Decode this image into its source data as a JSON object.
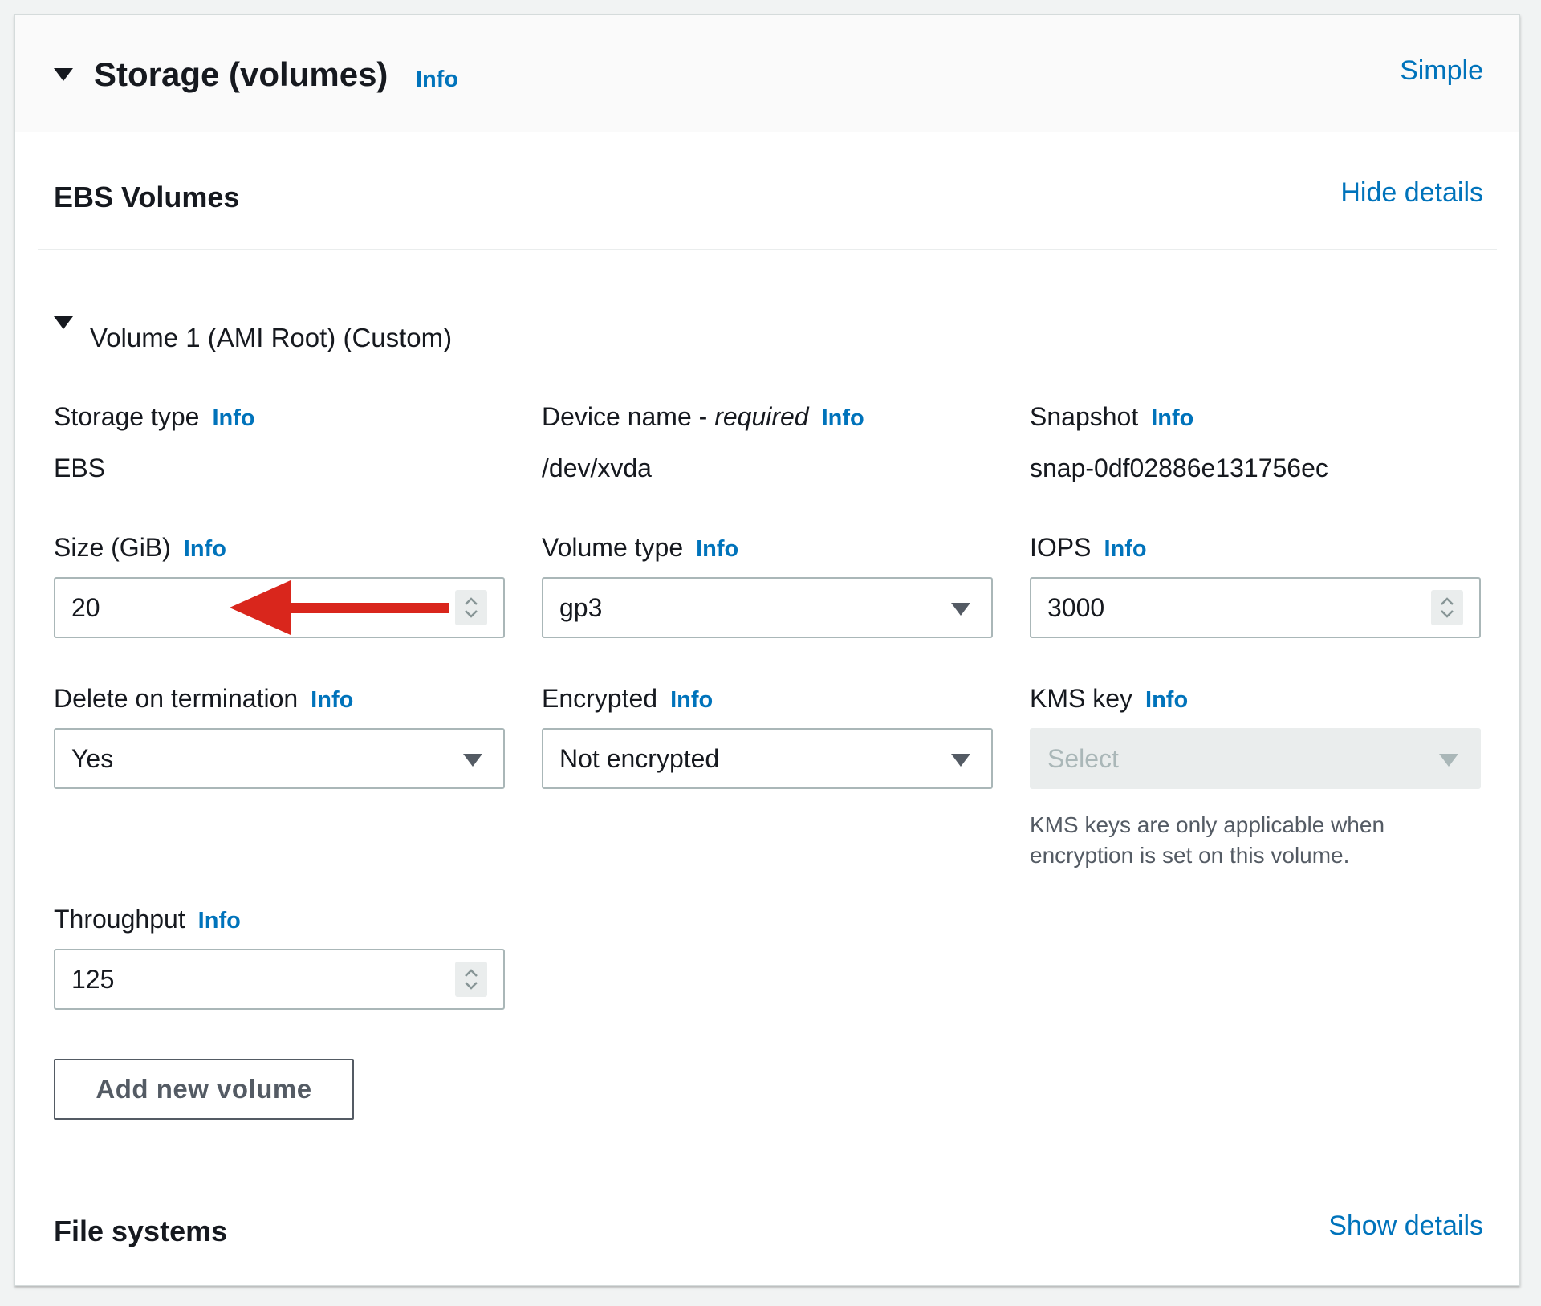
{
  "header": {
    "title": "Storage (volumes)",
    "info_label": "Info",
    "mode_link": "Simple"
  },
  "ebs": {
    "title": "EBS Volumes",
    "toggle_link": "Hide details",
    "volume_title": "Volume 1 (AMI Root) (Custom)"
  },
  "fields": {
    "storage_type": {
      "label": "Storage type",
      "info": "Info",
      "value": "EBS"
    },
    "device_name": {
      "label": "Device name - ",
      "label_em": "required",
      "info": "Info",
      "value": "/dev/xvda"
    },
    "snapshot": {
      "label": "Snapshot",
      "info": "Info",
      "value": "snap-0df02886e131756ec"
    },
    "size": {
      "label": "Size (GiB)",
      "info": "Info",
      "value": "20"
    },
    "volume_type": {
      "label": "Volume type",
      "info": "Info",
      "value": "gp3"
    },
    "iops": {
      "label": "IOPS",
      "info": "Info",
      "value": "3000"
    },
    "delete_on_termination": {
      "label": "Delete on termination",
      "info": "Info",
      "value": "Yes"
    },
    "encrypted": {
      "label": "Encrypted",
      "info": "Info",
      "value": "Not encrypted"
    },
    "kms_key": {
      "label": "KMS key",
      "info": "Info",
      "placeholder": "Select",
      "helper_line1": "KMS keys are only applicable when",
      "helper_line2": "encryption is set on this volume."
    },
    "throughput": {
      "label": "Throughput",
      "info": "Info",
      "value": "125"
    }
  },
  "actions": {
    "add_volume": "Add new volume"
  },
  "file_systems": {
    "title": "File systems",
    "toggle_link": "Show details"
  },
  "colors": {
    "link": "#0073bb",
    "annotation_arrow": "#d9261c",
    "border": "#aab7b8",
    "disabled_bg": "#eaeded"
  },
  "icons": {
    "collapse": "caret-down-icon",
    "dropdown": "dropdown-caret-icon",
    "stepper": "stepper-icon",
    "annotation": "red-arrow-annotation"
  }
}
